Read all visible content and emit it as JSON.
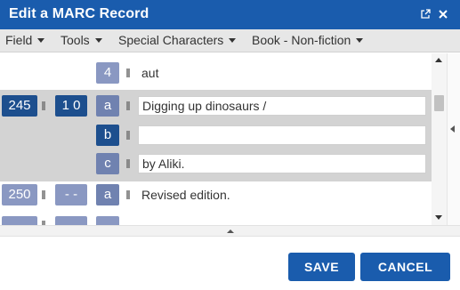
{
  "dialog": {
    "title": "Edit a MARC Record"
  },
  "icons": {
    "popout": "popout-icon",
    "close": "close-icon"
  },
  "menu": {
    "items": [
      {
        "label": "Field"
      },
      {
        "label": "Tools"
      },
      {
        "label": "Special Characters"
      },
      {
        "label": "Book - Non-fiction"
      }
    ]
  },
  "record": {
    "partial_row": {
      "subfield": "4",
      "value": "aut"
    },
    "field_245": {
      "tag": "245",
      "indicators": "1 0",
      "subfields": [
        {
          "code": "a",
          "value": "Digging up dinosaurs /"
        },
        {
          "code": "b",
          "value": ""
        },
        {
          "code": "c",
          "value": "by Aliki."
        }
      ]
    },
    "field_250": {
      "tag": "250",
      "indicators": "- -",
      "subfields": [
        {
          "code": "a",
          "value": "Revised edition."
        }
      ]
    }
  },
  "footer": {
    "save_label": "SAVE",
    "cancel_label": "CANCEL"
  },
  "colors": {
    "accent": "#1a5cad",
    "tag_dark": "#1d4f8e",
    "tag_mid": "#7082b0",
    "selected_row": "#d3d3d3"
  }
}
